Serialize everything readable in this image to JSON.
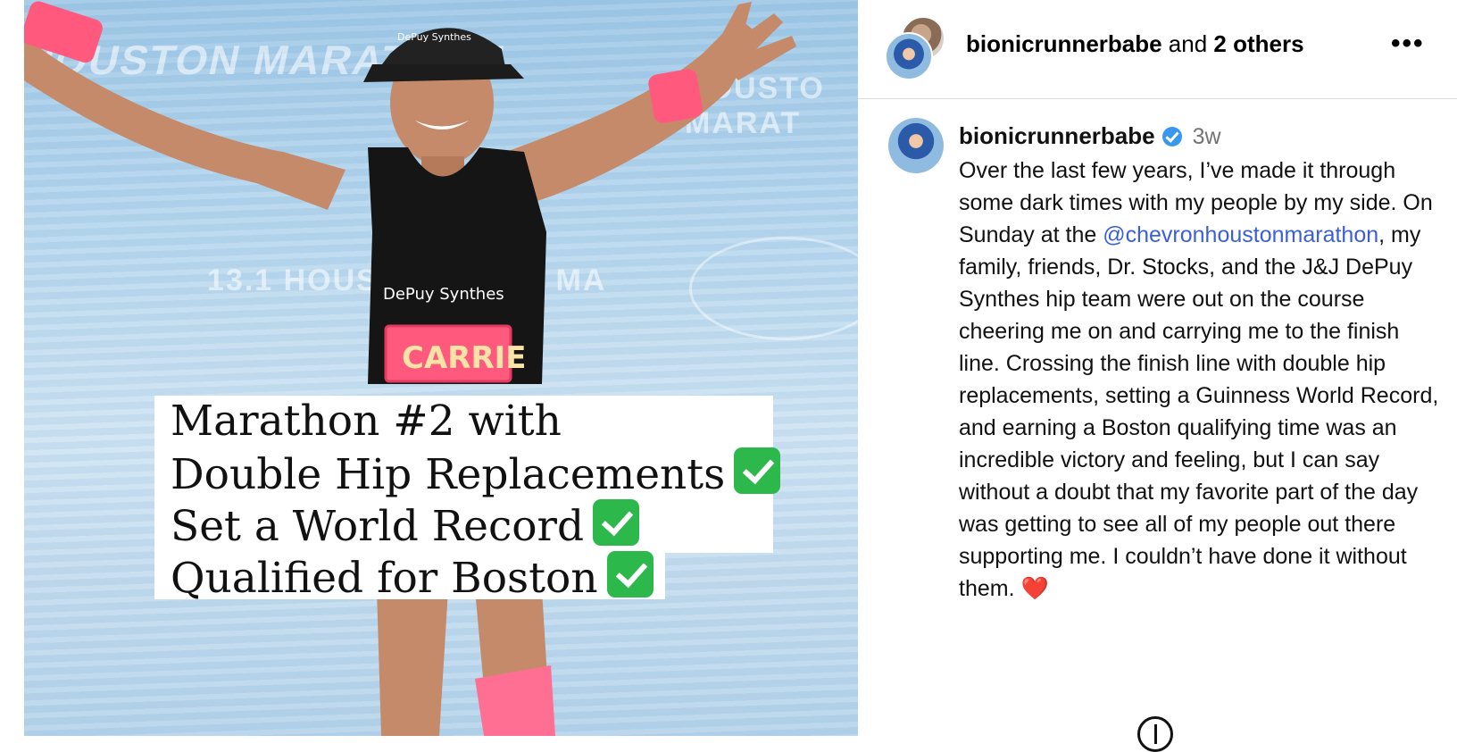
{
  "media": {
    "watermarks": [
      "HOUSTON MARATHON",
      "HOUSTO MARAT",
      "13.1 HOUSTON HALF MA"
    ],
    "bib_name": "CARRIE",
    "shirt_brand": "DePuy Synthes",
    "cap_brand": "DePuy Synthes",
    "caption_lines": [
      "Marathon #2 with",
      "Double Hip Replacements",
      "Set a World Record",
      "Qualified for Boston"
    ]
  },
  "header": {
    "username": "bionicrunnerbabe",
    "and_text": " and ",
    "others": "2 others",
    "more_label": "•••"
  },
  "post": {
    "username": "bionicrunnerbabe",
    "time": "3w",
    "text_before_mention": "Over the last few years, I’ve made it through some dark times with my people by my side. On Sunday at the ",
    "mention": "@chevronhoustonmarathon",
    "text_after_mention": ", my family, friends, Dr. Stocks, and the J&J DePuy Synthes hip team were out on the course cheering me on and carrying me to the finish line. Crossing the finish line with double hip replacements, setting a Guinness World Record, and earning a Boston qualifying time was an incredible victory and feeling, but I can say without a doubt that my favorite part of the day was getting to see all of my people out there supporting me. I couldn’t have done it without them. ",
    "heart": "❤️"
  },
  "colors": {
    "accent_link": "#3a5fd9",
    "verified": "#3897f0",
    "check": "#2db84b",
    "muted": "#737373"
  }
}
